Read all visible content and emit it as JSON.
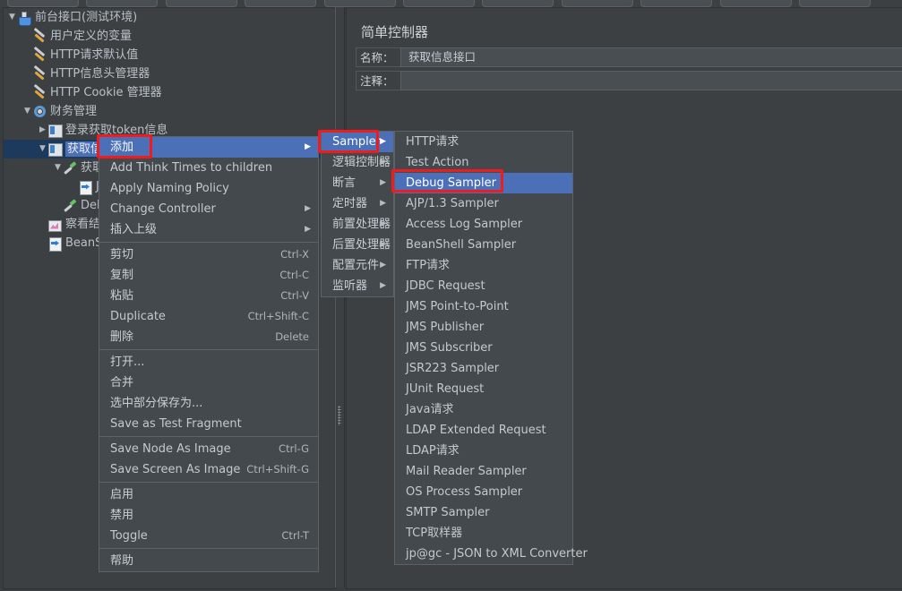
{
  "toolbar": {
    "button_count": 9
  },
  "tree": {
    "items": [
      {
        "label": "前台接口(测试环境)",
        "icon": "test-plan-icon",
        "depth": 0,
        "twisty": "▼",
        "selected": false
      },
      {
        "label": "用户定义的变量",
        "icon": "config-element-icon",
        "depth": 1,
        "twisty": "",
        "selected": false
      },
      {
        "label": "HTTP请求默认值",
        "icon": "config-element-icon",
        "depth": 1,
        "twisty": "",
        "selected": false
      },
      {
        "label": "HTTP信息头管理器",
        "icon": "config-element-icon",
        "depth": 1,
        "twisty": "",
        "selected": false
      },
      {
        "label": "HTTP Cookie 管理器",
        "icon": "config-element-icon",
        "depth": 1,
        "twisty": "",
        "selected": false
      },
      {
        "label": "财务管理",
        "icon": "thread-group-icon",
        "depth": 1,
        "twisty": "▼",
        "selected": false
      },
      {
        "label": "登录获取token信息",
        "icon": "controller-icon",
        "depth": 2,
        "twisty": "▶",
        "selected": false
      },
      {
        "label": "获取信息接口",
        "icon": "controller-icon",
        "depth": 2,
        "twisty": "▼",
        "selected": true
      },
      {
        "label": "获取信息",
        "icon": "sampler-icon",
        "depth": 3,
        "twisty": "▼",
        "selected": false
      },
      {
        "label": "JSON",
        "icon": "post-processor-icon",
        "depth": 4,
        "twisty": "",
        "selected": false
      },
      {
        "label": "Debug Sa",
        "icon": "sampler-icon",
        "depth": 3,
        "twisty": "",
        "selected": false
      },
      {
        "label": "察看结果树",
        "icon": "listener-icon",
        "depth": 2,
        "twisty": "",
        "selected": false
      },
      {
        "label": "BeanShell",
        "icon": "post-processor-icon",
        "depth": 2,
        "twisty": "",
        "selected": false
      }
    ]
  },
  "right_panel": {
    "title": "简单控制器",
    "name_label": "名称：",
    "name_value": "获取信息接口",
    "comment_label": "注释：",
    "comment_value": ""
  },
  "context_menu": {
    "items": [
      {
        "label": "添加",
        "accel": "",
        "arrow": "▶",
        "highlighted": true,
        "cn": true
      },
      {
        "label": "Add Think Times to children",
        "accel": "",
        "arrow": "",
        "highlighted": false,
        "cn": false
      },
      {
        "label": "Apply Naming Policy",
        "accel": "",
        "arrow": "",
        "highlighted": false,
        "cn": false
      },
      {
        "label": "Change Controller",
        "accel": "",
        "arrow": "▶",
        "highlighted": false,
        "cn": false
      },
      {
        "label": "插入上级",
        "accel": "",
        "arrow": "▶",
        "highlighted": false,
        "cn": true
      },
      {
        "separator": true
      },
      {
        "label": "剪切",
        "accel": "Ctrl-X",
        "arrow": "",
        "highlighted": false,
        "cn": true
      },
      {
        "label": "复制",
        "accel": "Ctrl-C",
        "arrow": "",
        "highlighted": false,
        "cn": true
      },
      {
        "label": "粘贴",
        "accel": "Ctrl-V",
        "arrow": "",
        "highlighted": false,
        "cn": true
      },
      {
        "label": "Duplicate",
        "accel": "Ctrl+Shift-C",
        "arrow": "",
        "highlighted": false,
        "cn": false
      },
      {
        "label": "删除",
        "accel": "Delete",
        "arrow": "",
        "highlighted": false,
        "cn": true
      },
      {
        "separator": true
      },
      {
        "label": "打开...",
        "accel": "",
        "arrow": "",
        "highlighted": false,
        "cn": true
      },
      {
        "label": "合并",
        "accel": "",
        "arrow": "",
        "highlighted": false,
        "cn": true
      },
      {
        "label": "选中部分保存为...",
        "accel": "",
        "arrow": "",
        "highlighted": false,
        "cn": true
      },
      {
        "label": "Save as Test Fragment",
        "accel": "",
        "arrow": "",
        "highlighted": false,
        "cn": false
      },
      {
        "separator": true
      },
      {
        "label": "Save Node As Image",
        "accel": "Ctrl-G",
        "arrow": "",
        "highlighted": false,
        "cn": false
      },
      {
        "label": "Save Screen As Image",
        "accel": "Ctrl+Shift-G",
        "arrow": "",
        "highlighted": false,
        "cn": false
      },
      {
        "separator": true
      },
      {
        "label": "启用",
        "accel": "",
        "arrow": "",
        "highlighted": false,
        "cn": true
      },
      {
        "label": "禁用",
        "accel": "",
        "arrow": "",
        "highlighted": false,
        "cn": true
      },
      {
        "label": "Toggle",
        "accel": "Ctrl-T",
        "arrow": "",
        "highlighted": false,
        "cn": false
      },
      {
        "separator": true
      },
      {
        "label": "帮助",
        "accel": "",
        "arrow": "",
        "highlighted": false,
        "cn": true
      }
    ]
  },
  "add_submenu": {
    "items": [
      {
        "label": "Sampler",
        "arrow": "▶",
        "highlighted": true,
        "cn": false
      },
      {
        "label": "逻辑控制器",
        "arrow": "▶",
        "highlighted": false,
        "cn": true
      },
      {
        "label": "断言",
        "arrow": "▶",
        "highlighted": false,
        "cn": true
      },
      {
        "label": "定时器",
        "arrow": "▶",
        "highlighted": false,
        "cn": true
      },
      {
        "label": "前置处理器",
        "arrow": "▶",
        "highlighted": false,
        "cn": true
      },
      {
        "label": "后置处理器",
        "arrow": "▶",
        "highlighted": false,
        "cn": true
      },
      {
        "label": "配置元件",
        "arrow": "▶",
        "highlighted": false,
        "cn": true
      },
      {
        "label": "监听器",
        "arrow": "▶",
        "highlighted": false,
        "cn": true
      }
    ]
  },
  "sampler_submenu": {
    "items": [
      {
        "label": "HTTP请求",
        "highlighted": false
      },
      {
        "label": "Test Action",
        "highlighted": false
      },
      {
        "label": "Debug Sampler",
        "highlighted": true
      },
      {
        "label": "AJP/1.3 Sampler",
        "highlighted": false
      },
      {
        "label": "Access Log Sampler",
        "highlighted": false
      },
      {
        "label": "BeanShell Sampler",
        "highlighted": false
      },
      {
        "label": "FTP请求",
        "highlighted": false
      },
      {
        "label": "JDBC Request",
        "highlighted": false
      },
      {
        "label": "JMS Point-to-Point",
        "highlighted": false
      },
      {
        "label": "JMS Publisher",
        "highlighted": false
      },
      {
        "label": "JMS Subscriber",
        "highlighted": false
      },
      {
        "label": "JSR223 Sampler",
        "highlighted": false
      },
      {
        "label": "JUnit Request",
        "highlighted": false
      },
      {
        "label": "Java请求",
        "highlighted": false
      },
      {
        "label": "LDAP Extended Request",
        "highlighted": false
      },
      {
        "label": "LDAP请求",
        "highlighted": false
      },
      {
        "label": "Mail Reader Sampler",
        "highlighted": false
      },
      {
        "label": "OS Process Sampler",
        "highlighted": false
      },
      {
        "label": "SMTP Sampler",
        "highlighted": false
      },
      {
        "label": "TCP取样器",
        "highlighted": false
      },
      {
        "label": "jp@gc - JSON to XML Converter",
        "highlighted": false
      }
    ]
  },
  "annotations": {
    "color": "#ee1c1c",
    "boxes": [
      "add-menu-item",
      "sampler-submenu-item",
      "debug-sampler-item"
    ]
  }
}
